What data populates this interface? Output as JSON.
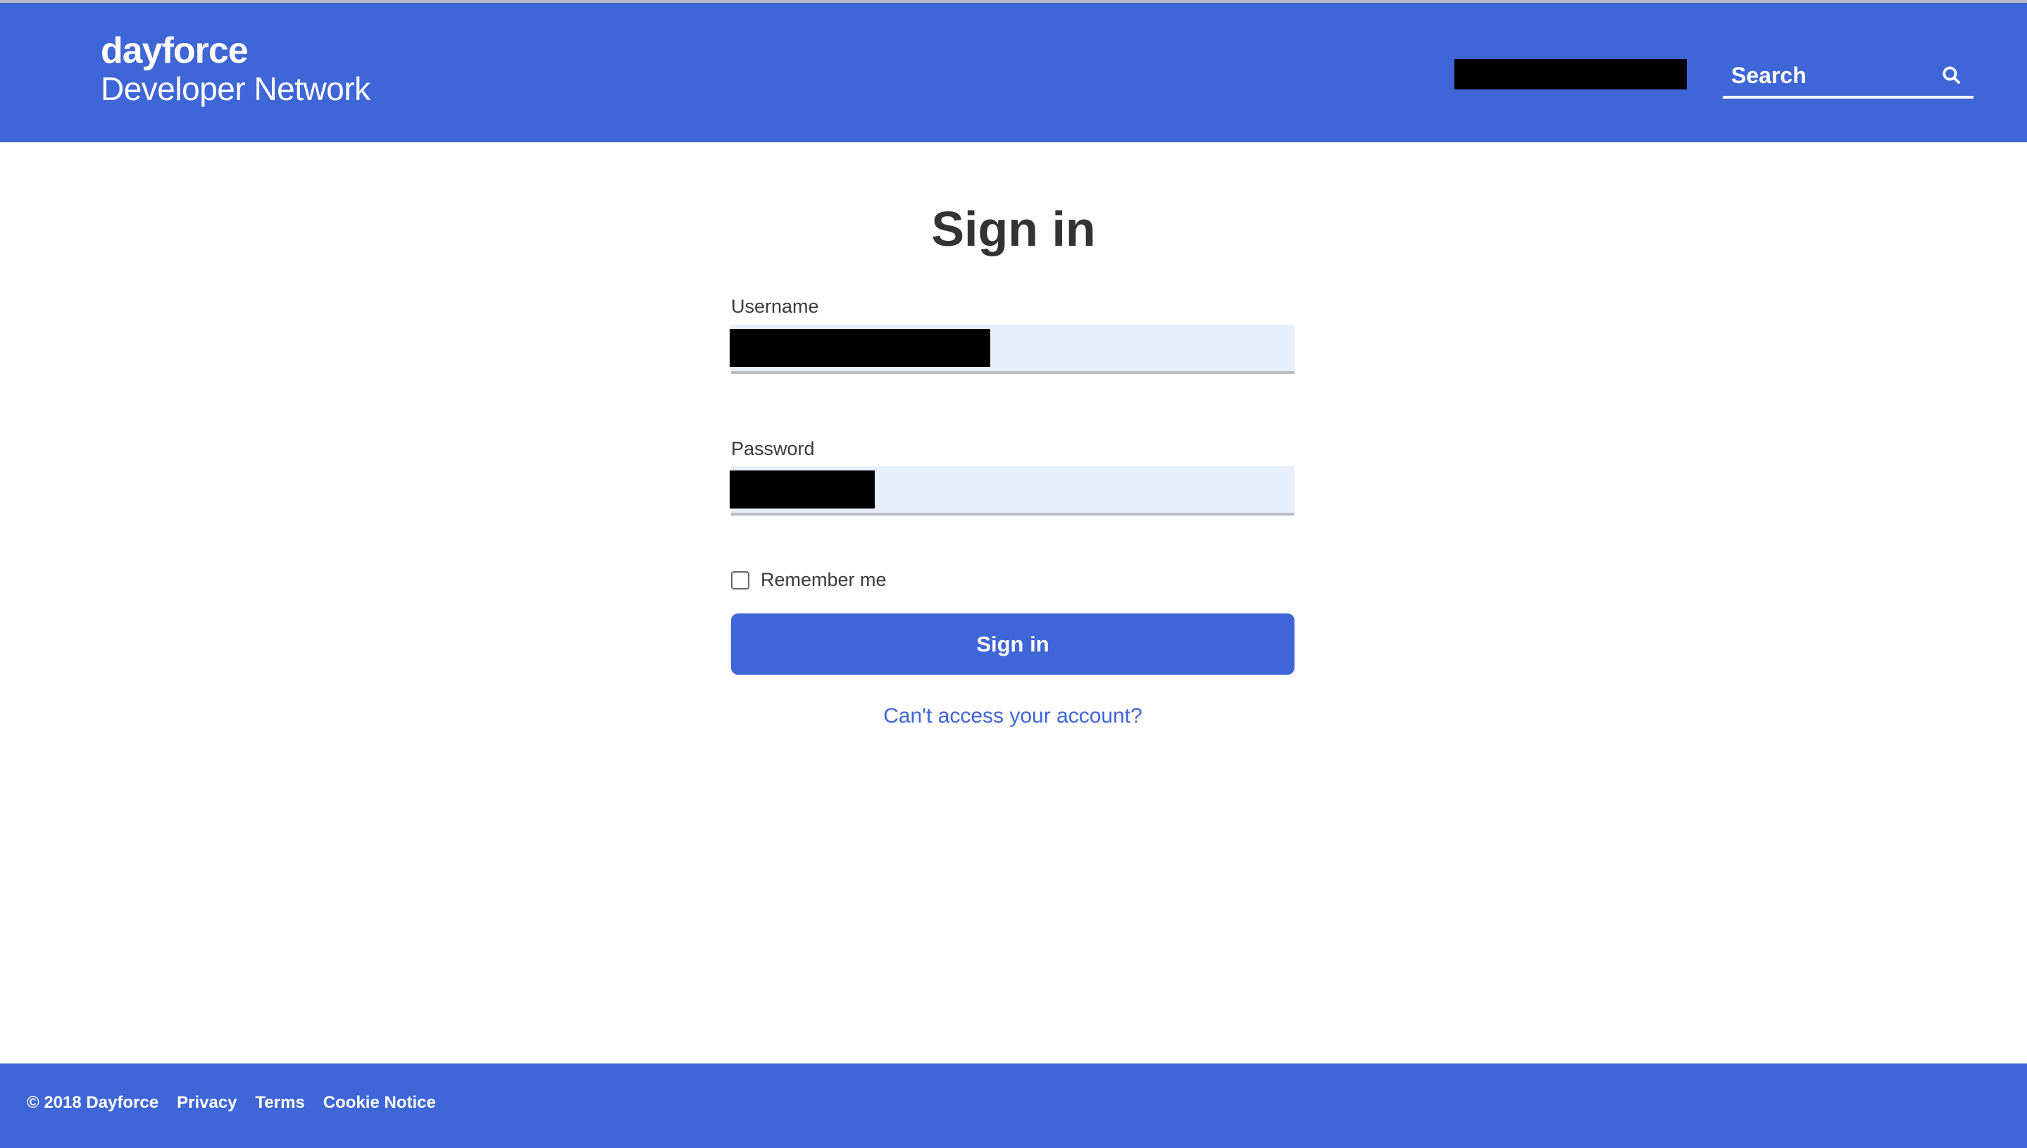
{
  "header": {
    "logo_brand": "dayforce",
    "logo_sub": "Developer Network",
    "search": {
      "placeholder": "Search",
      "icon": "search-icon"
    },
    "redacted_user": true
  },
  "main": {
    "title": "Sign in",
    "username": {
      "label": "Username",
      "value_redacted": true
    },
    "password": {
      "label": "Password",
      "value_redacted": true
    },
    "remember": {
      "label": "Remember me",
      "checked": false
    },
    "submit_label": "Sign in",
    "help_link": "Can't access your account?"
  },
  "footer": {
    "copyright": "© 2018 Dayforce",
    "links": [
      "Privacy",
      "Terms",
      "Cookie Notice"
    ]
  },
  "colors": {
    "brand": "#3f66d6",
    "input_bg": "#e8effc",
    "text": "#333333"
  }
}
